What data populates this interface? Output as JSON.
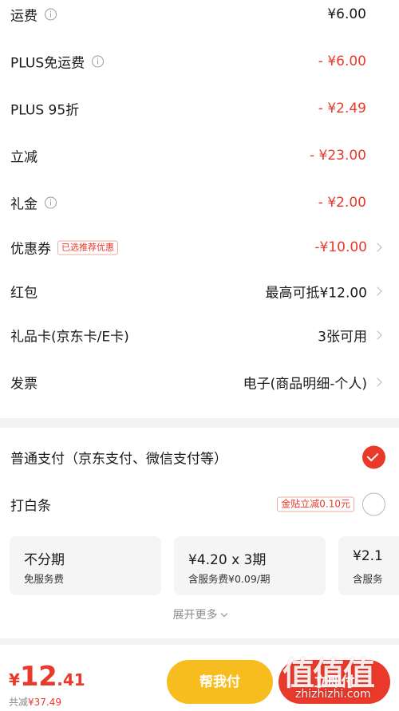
{
  "fees": {
    "shipping": {
      "label": "运费",
      "value": "¥6.00"
    },
    "plus_free_shipping": {
      "label": "PLUS免运费",
      "value": "- ¥6.00"
    },
    "plus_discount": {
      "label": "PLUS 95折",
      "value": "- ¥2.49"
    },
    "instant_discount": {
      "label": "立减",
      "value": "- ¥23.00"
    },
    "gift_money": {
      "label": "礼金",
      "value": "- ¥2.00"
    },
    "coupon": {
      "label": "优惠券",
      "tag": "已选推荐优惠",
      "value": "-¥10.00"
    },
    "red_packet": {
      "label": "红包",
      "value": "最高可抵¥12.00"
    },
    "gift_card": {
      "label": "礼品卡(京东卡/E卡)",
      "value": "3张可用"
    },
    "invoice": {
      "label": "发票",
      "value": "电子(商品明细-个人)"
    }
  },
  "payment": {
    "normal": {
      "label": "普通支付（京东支付、微信支付等）",
      "selected": true
    },
    "baitiao": {
      "label": "打白条",
      "promo": "金贴立减0.10元",
      "selected": false
    },
    "installments": [
      {
        "title": "不分期",
        "subtitle": "免服务费"
      },
      {
        "title": "¥4.20 x 3期",
        "subtitle": "含服务费¥0.09/期"
      },
      {
        "title": "¥2.1",
        "subtitle": "含服务"
      }
    ],
    "expand_label": "展开更多"
  },
  "bottom": {
    "price_symbol": "¥",
    "price_int": "12",
    "price_dec": ".41",
    "saved_label": "共减",
    "saved_value": "¥37.49",
    "help_pay_label": "帮我付",
    "pay_label": "立即付"
  },
  "watermark": {
    "mark": "值值值",
    "url": "zhizhizhi.com"
  },
  "colors": {
    "accent_red": "#e9392b",
    "help_yellow": "#f7bd1f",
    "divider_gray": "#f3f3f3"
  }
}
